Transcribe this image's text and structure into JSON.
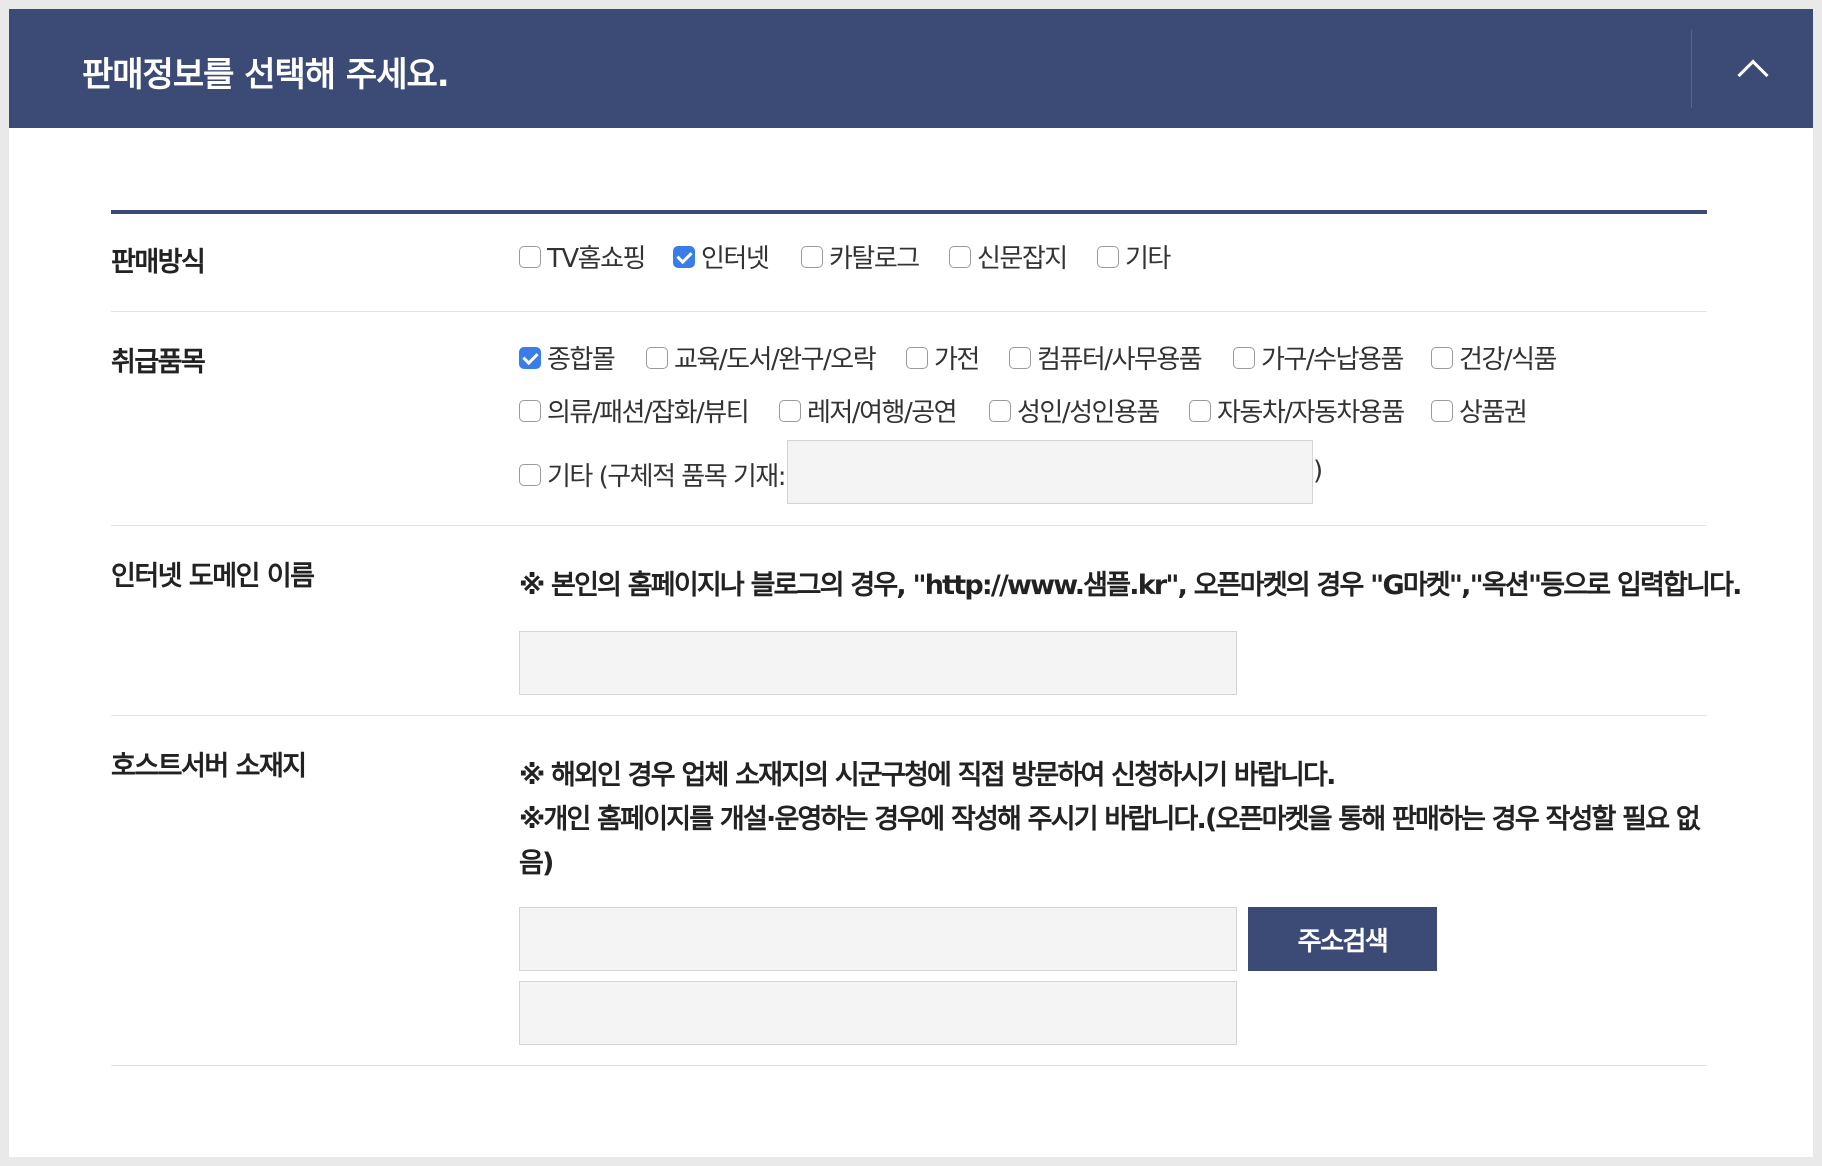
{
  "header": {
    "title": "판매정보를 선택해 주세요.",
    "toggle_icon": "chevron-up-icon"
  },
  "sales_method": {
    "label": "판매방식",
    "options": [
      {
        "label": "TV홈쇼핑",
        "checked": false
      },
      {
        "label": "인터넷",
        "checked": true
      },
      {
        "label": "카탈로그",
        "checked": false
      },
      {
        "label": "신문잡지",
        "checked": false
      },
      {
        "label": "기타",
        "checked": false
      }
    ]
  },
  "items": {
    "label": "취급품목",
    "options": [
      {
        "label": "종합몰",
        "checked": true
      },
      {
        "label": "교육/도서/완구/오락",
        "checked": false
      },
      {
        "label": "가전",
        "checked": false
      },
      {
        "label": "컴퓨터/사무용품",
        "checked": false
      },
      {
        "label": "가구/수납용품",
        "checked": false
      },
      {
        "label": "건강/식품",
        "checked": false
      },
      {
        "label": "의류/패션/잡화/뷰티",
        "checked": false
      },
      {
        "label": "레저/여행/공연",
        "checked": false
      },
      {
        "label": "성인/성인용품",
        "checked": false
      },
      {
        "label": "자동차/자동차용품",
        "checked": false
      },
      {
        "label": "상품권",
        "checked": false
      }
    ],
    "other": {
      "label": "기타 (구체적 품목 기재:",
      "close_paren": ")",
      "value": "",
      "checked": false
    }
  },
  "domain": {
    "label": "인터넷 도메인 이름",
    "note": "※ 본인의 홈페이지나 블로그의 경우, \"http://www.샘플.kr\", 오픈마켓의 경우 \"G마켓\",\"옥션\"등으로 입력합니다.",
    "value": ""
  },
  "host": {
    "label": "호스트서버 소재지",
    "note1": "※ 해외인 경우 업체 소재지의 시군구청에 직접 방문하여 신청하시기 바랍니다.",
    "note2_line1": "※개인 홈페이지를 개설·운영하는 경우에 작성해 주시기 바랍니다.(오픈마켓을 통해 판매하는 경우 작성할 필요 없",
    "note2_line2": "음)",
    "address_search_label": "주소검색",
    "address1": "",
    "address2": ""
  },
  "colors": {
    "header_bg": "#3b4b75",
    "checkbox_checked": "#3a7de8",
    "input_bg": "#f4f4f4"
  }
}
